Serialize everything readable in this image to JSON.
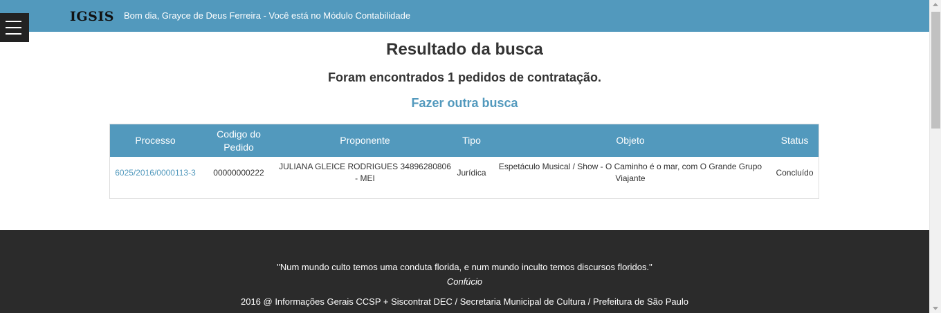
{
  "header": {
    "logo": "IGSIS",
    "greeting": "Bom dia, Grayce de Deus Ferreira - Você está no Módulo Contabilidade",
    "accent_color": "#5299bd",
    "menu_icon": "hamburger-menu-icon"
  },
  "main": {
    "title": "Resultado da busca",
    "subtitle": "Foram encontrados 1 pedidos de contratação.",
    "search_again_link": "Fazer outra busca"
  },
  "table": {
    "columns": [
      "Processo",
      "Codigo do Pedido",
      "Proponente",
      "Tipo",
      "Objeto",
      "Status"
    ],
    "rows": [
      {
        "processo": "6025/2016/0000113-3",
        "codigo": "00000000222",
        "proponente": "JULIANA GLEICE RODRIGUES 34896280806 - MEI",
        "tipo": "Jurídica",
        "objeto": "Espetáculo Musical / Show - O Caminho é o mar, com O Grande Grupo Viajante",
        "status": "Concluído"
      }
    ]
  },
  "footer": {
    "quote": "\"Num mundo culto temos uma conduta florida, e num mundo inculto temos discursos floridos.\"",
    "author": "Confúcio",
    "copyright": "2016 @ Informações Gerais CCSP + Siscontrat DEC / Secretaria Municipal de Cultura / Prefeitura de São Paulo",
    "background_color": "#2b2b2b"
  }
}
